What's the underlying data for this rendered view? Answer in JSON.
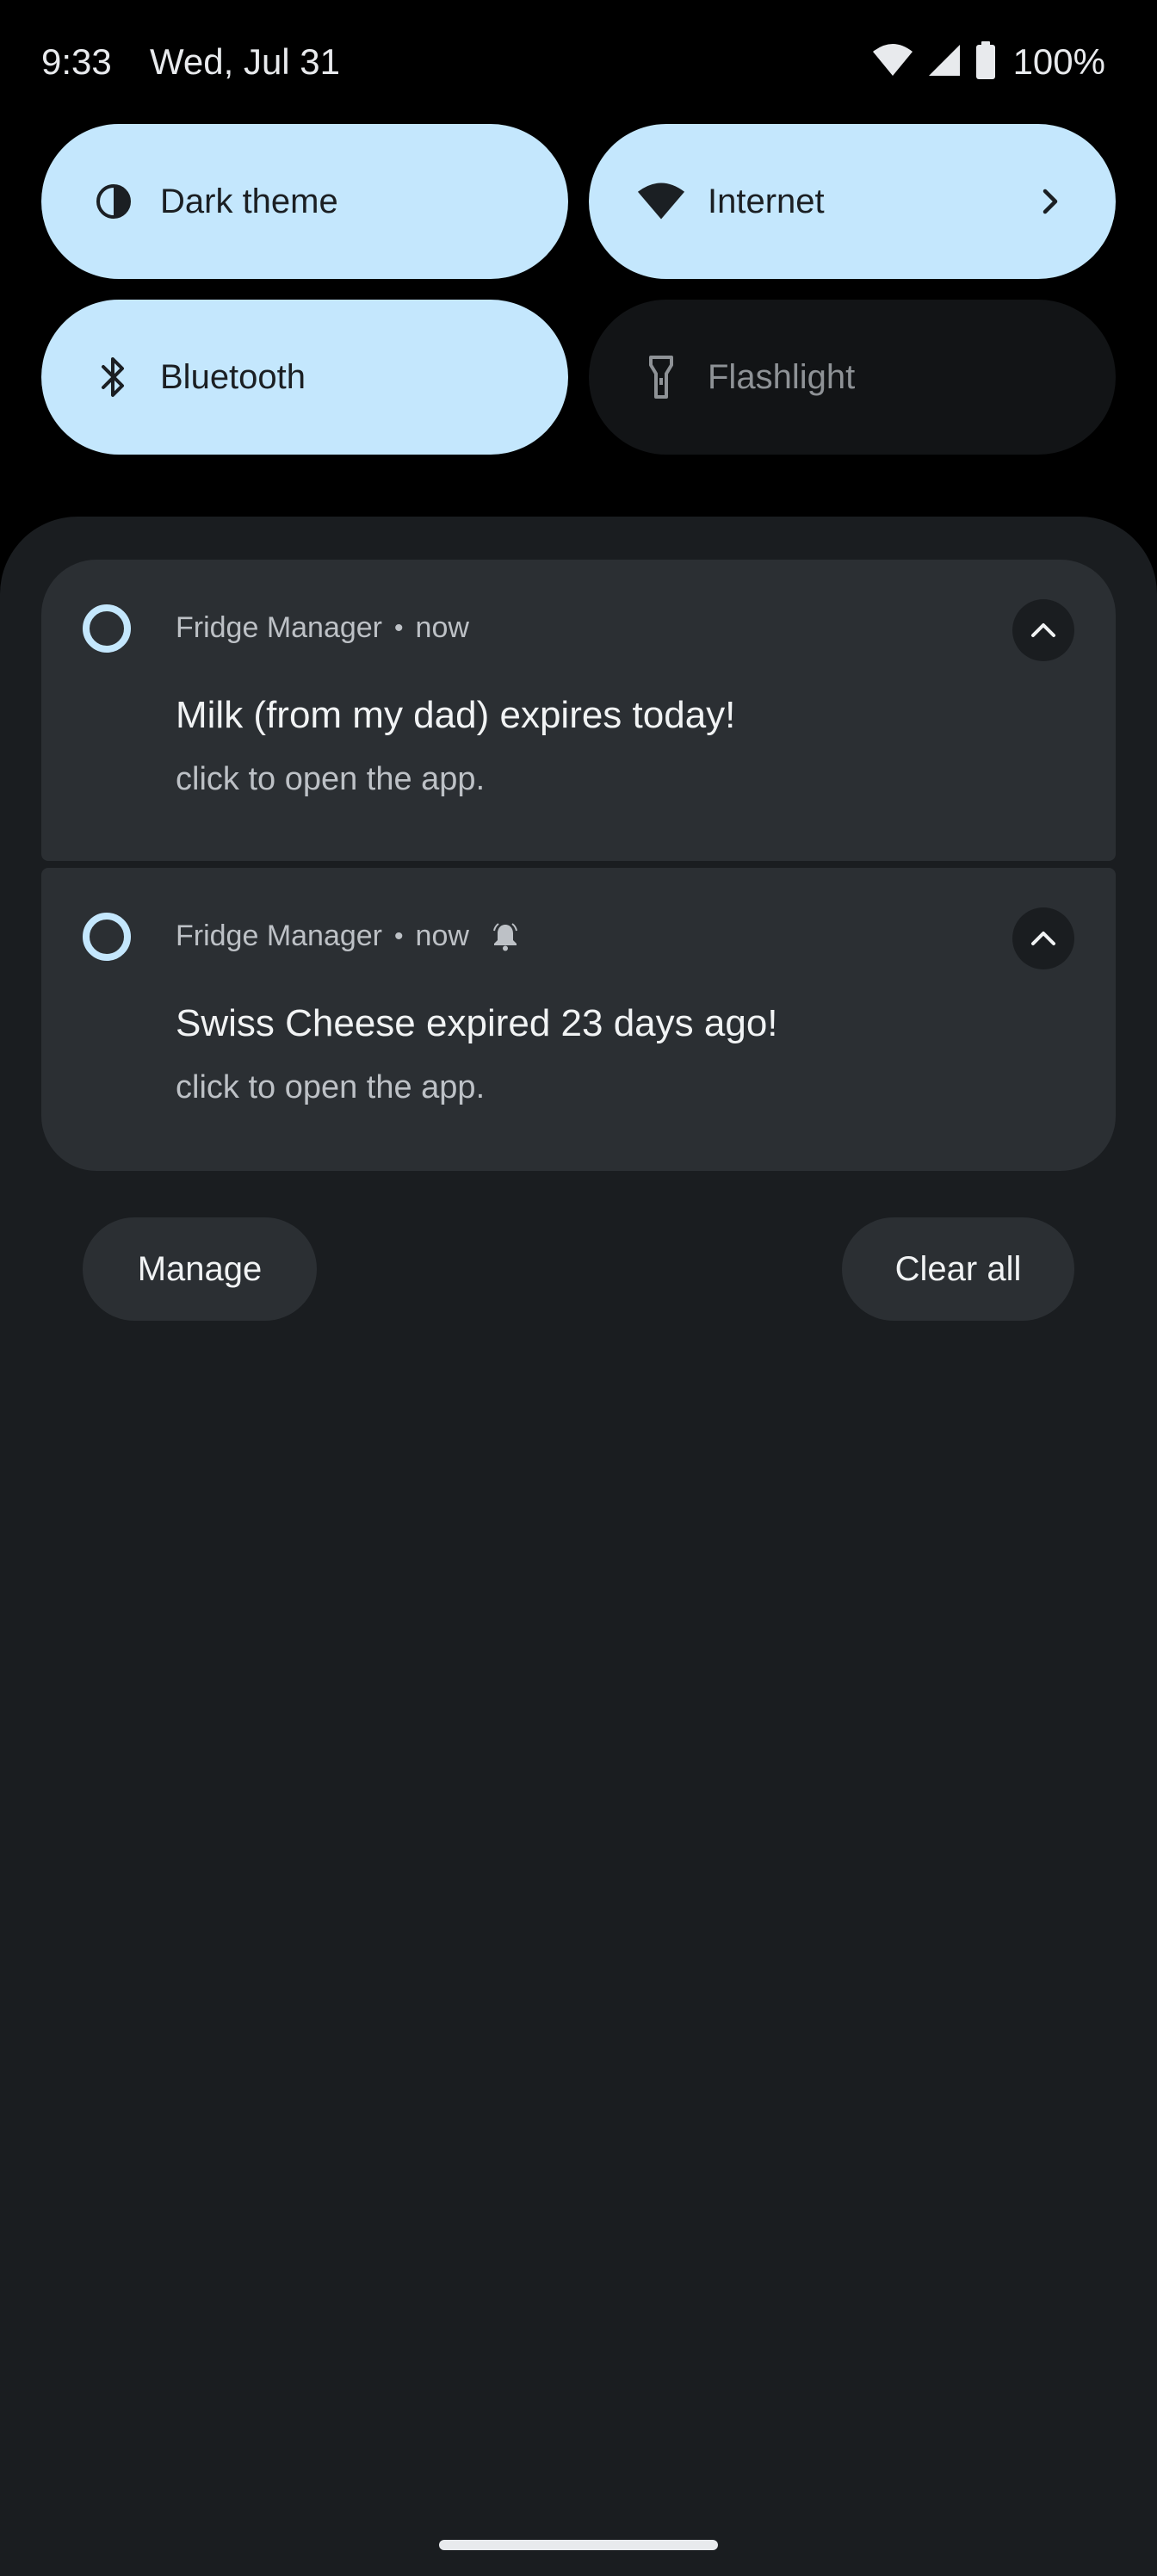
{
  "status_bar": {
    "time": "9:33",
    "date": "Wed, Jul 31",
    "battery": "100%",
    "icons": [
      "wifi-icon",
      "cell-signal-icon",
      "battery-icon"
    ]
  },
  "quick_settings": [
    {
      "label": "Dark theme",
      "icon": "contrast-icon",
      "active": true
    },
    {
      "label": "Internet",
      "icon": "wifi-icon",
      "active": true,
      "has_chevron": true
    },
    {
      "label": "Bluetooth",
      "icon": "bluetooth-icon",
      "active": true
    },
    {
      "label": "Flashlight",
      "icon": "flashlight-icon",
      "active": false
    }
  ],
  "notifications": [
    {
      "app": "Fridge Manager",
      "time": "now",
      "title": "Milk (from my dad) expires today!",
      "text": "click to open the app.",
      "alerted": false
    },
    {
      "app": "Fridge Manager",
      "time": "now",
      "title": "Swiss Cheese expired 23 days ago!",
      "text": "click to open the app.",
      "alerted": true
    }
  ],
  "footer": {
    "manage_label": "Manage",
    "clear_all_label": "Clear all"
  },
  "colors": {
    "tile_active": "#c4e7fd",
    "tile_inactive": "#121416",
    "shade": "#1a1d20",
    "notification_card": "#2b2f33"
  }
}
